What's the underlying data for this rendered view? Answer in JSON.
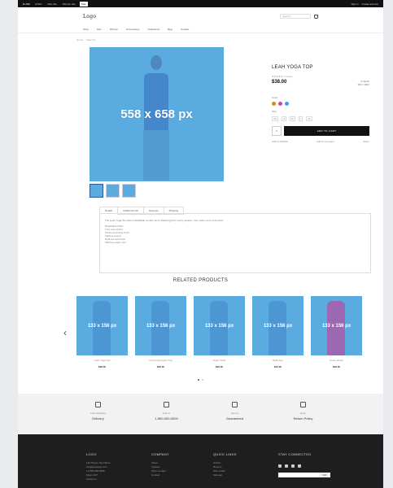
{
  "topbar": {
    "currency": "$ USD",
    "sites": [
      "LOGO",
      "Men site",
      "Women site",
      "Kids"
    ],
    "active_site": 3,
    "right": [
      "Sign in",
      "Create account"
    ]
  },
  "header": {
    "logo": "Logo",
    "search_placeholder": "Search..."
  },
  "nav": [
    "Shop",
    "Men",
    "Women",
    "Accessories",
    "Collections",
    "Blog",
    "Contact"
  ],
  "breadcrumb": [
    "Home",
    "Yoga Top"
  ],
  "gallery": {
    "main_label": "558 x 658 px"
  },
  "product": {
    "title": "LEAH YOGA TOP",
    "rating": "★★★★★ 1 review",
    "price": "$38.00",
    "stock": [
      "In Stock",
      "SKU: 1027"
    ],
    "color_label": "Color:",
    "colors": [
      "#e8821c",
      "#c048b0",
      "#3fa0e8"
    ],
    "size_label": "Size:",
    "sizes": [
      "XS",
      "S",
      "M",
      "L",
      "XL"
    ],
    "qty": "1",
    "add_to_cart": "ADD TO CART",
    "links": [
      "Add to Wishlist",
      "Add to Compare",
      "Share"
    ]
  },
  "tabs": {
    "items": [
      "Details",
      "Additional Info",
      "Reviews",
      "Shipping"
    ],
    "description": "The Leah Yoga Top offers breathable comfort and a flattering fit for every session, from warm-up to cool-down.",
    "bullets": [
      "Breathable fabric",
      "Four-way stretch",
      "Moisture-wicking finish",
      "Flatlock seams",
      "Relaxed racerback",
      "Machine wash cold"
    ]
  },
  "related": {
    "title": "RELATED PRODUCTS",
    "items": [
      {
        "img": "133 x 156 px",
        "name": "Leah Yoga Top",
        "price": "$38.00"
      },
      {
        "img": "133 x 156 px",
        "name": "Ina Compression Top",
        "price": "$32.00"
      },
      {
        "img": "133 x 156 px",
        "name": "Gwen Tank",
        "price": "$29.00"
      },
      {
        "img": "133 x 156 px",
        "name": "Bella Tee",
        "price": "$34.00"
      },
      {
        "img": "133 x 156 px",
        "name": "Nona Jacket",
        "price": "$39.00"
      }
    ]
  },
  "features": [
    {
      "caption": "Free Shipping",
      "value": "Delivery"
    },
    {
      "caption": "Call us",
      "value": "1-800-000-0000"
    },
    {
      "caption": "Secure",
      "value": "Guaranteed"
    },
    {
      "caption": "Easy",
      "value": "Return Policy"
    }
  ],
  "footer": {
    "logo": "LOGO",
    "about": [
      "123 Street, City Name",
      "info@example.com",
      "+1 800 000 0000",
      "Open 24/7",
      "Follow us"
    ],
    "col2_title": "COMPANY",
    "col2": [
      "About",
      "Careers",
      "Store Locator",
      "Contact"
    ],
    "col3_title": "QUICK LINKS",
    "col3": [
      "Orders",
      "Returns",
      "Size Guide",
      "Sitemap"
    ],
    "col4_title": "STAY CONNECTED",
    "subscribe": "GO"
  }
}
